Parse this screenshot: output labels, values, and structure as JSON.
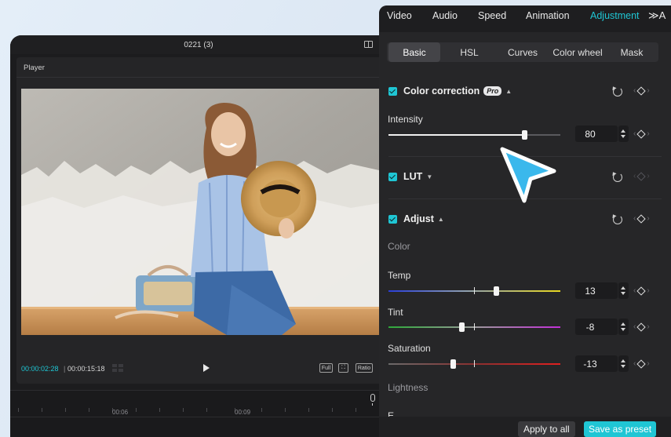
{
  "player": {
    "window_title": "0221 (3)",
    "panel_label": "Player",
    "current_time": "00:00:02:28",
    "total_time": "00:00:15:18",
    "buttons": {
      "full": "Full",
      "ratio": "Ratio"
    }
  },
  "timeline": {
    "ruler_labels": [
      "00:06",
      "00:09"
    ]
  },
  "inspector": {
    "tabs": [
      "Video",
      "Audio",
      "Speed",
      "Animation",
      "Adjustment"
    ],
    "active_tab": "Adjustment",
    "more_glyph": "≫A",
    "subtabs": [
      "Basic",
      "HSL",
      "Curves",
      "Color wheel",
      "Mask"
    ],
    "active_subtab": "Basic",
    "color_correction": {
      "title": "Color correction",
      "badge": "Pro",
      "intensity_label": "Intensity",
      "intensity_value": "80",
      "intensity_fraction": 0.79
    },
    "lut": {
      "title": "LUT"
    },
    "adjust": {
      "title": "Adjust",
      "color_group": "Color",
      "temp": {
        "label": "Temp",
        "value": "13"
      },
      "tint": {
        "label": "Tint",
        "value": "-8"
      },
      "saturation": {
        "label": "Saturation",
        "value": "-13"
      },
      "lightness_group": "Lightness",
      "next_partial": "E"
    },
    "footer": {
      "apply_all": "Apply to all",
      "save_preset": "Save as preset"
    }
  },
  "colors": {
    "accent": "#1fc6d4",
    "panel_bg": "#262628",
    "cursor": "#3ab8ec"
  }
}
